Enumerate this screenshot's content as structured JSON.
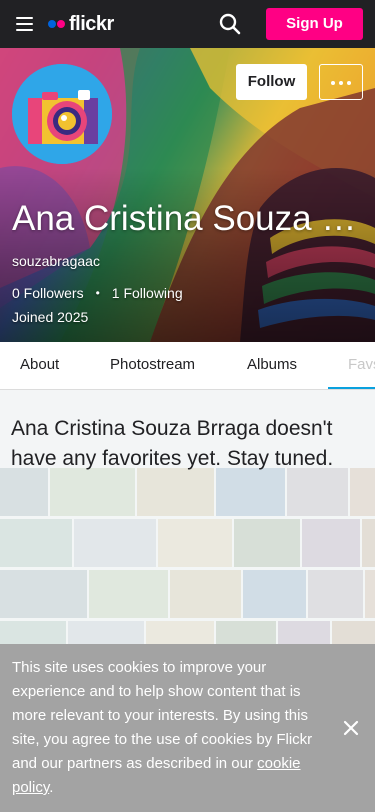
{
  "nav": {
    "logo_text": "flickr",
    "signup_label": "Sign Up",
    "icons": [
      "hamburger-menu-icon",
      "search-icon"
    ],
    "colors": {
      "bar": "#212124",
      "signup": "#ff0084",
      "logo_blue": "#0063dc",
      "logo_pink": "#ff0084"
    }
  },
  "profile": {
    "name": "Ana Cristina Souza B...",
    "username": "souzabragaac",
    "followers": "0 Followers",
    "separator": "•",
    "following": "1 Following",
    "joined": "Joined 2025",
    "follow_label": "Follow",
    "more_icon": "ellipsis-icon"
  },
  "tabs": {
    "items": [
      "About",
      "Photostream",
      "Albums",
      "Favs"
    ],
    "active": "Favs",
    "accent": "#0aa1de"
  },
  "favorites": {
    "empty_message": "Ana Cristina Souza Brraga doesn't have any favorites yet. Stay tuned."
  },
  "cookie": {
    "text": "This site uses cookies to improve your experience and to help show content that is more relevant to your interests. By using this site, you agree to the use of cookies by Flickr and our partners as described in our ",
    "link": "cookie policy",
    "suffix": ".",
    "close_icon": "close-icon"
  }
}
